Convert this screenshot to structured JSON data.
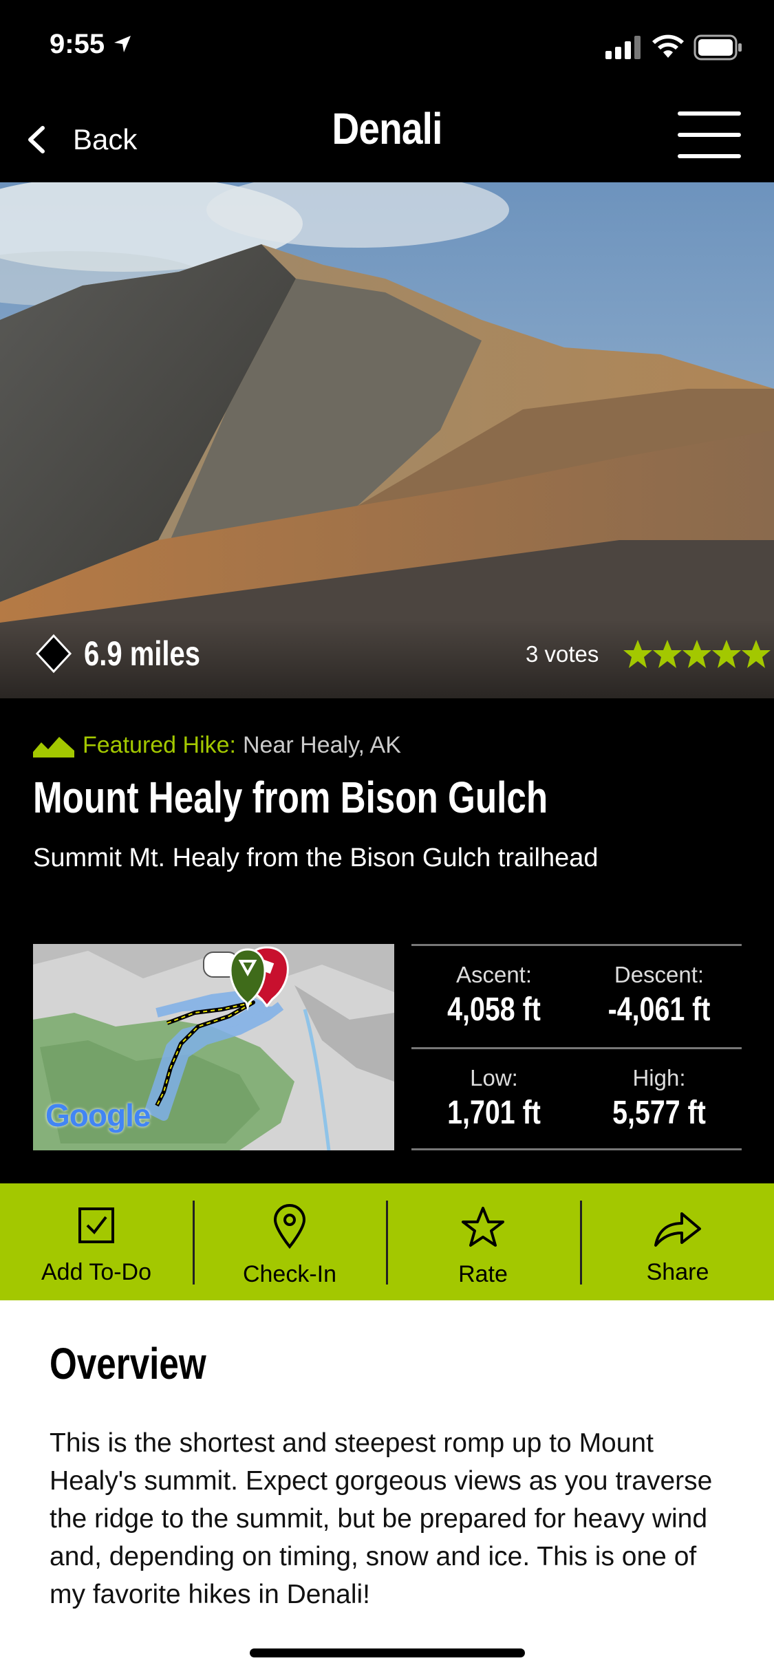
{
  "status": {
    "time": "9:55"
  },
  "nav": {
    "back_label": "Back",
    "title": "Denali"
  },
  "hero": {
    "distance": "6.9 miles",
    "votes": "3 votes",
    "rating_stars": 5
  },
  "hike": {
    "featured_label": "Featured Hike:",
    "location": "Near Healy, AK",
    "title": "Mount Healy from Bison Gulch",
    "subtitle": "Summit Mt. Healy from the Bison Gulch trailhead"
  },
  "map": {
    "logo": "Google"
  },
  "stats": {
    "ascent_label": "Ascent:",
    "ascent_value": "4,058 ft",
    "descent_label": "Descent:",
    "descent_value": "-4,061 ft",
    "low_label": "Low:",
    "low_value": "1,701 ft",
    "high_label": "High:",
    "high_value": "5,577 ft"
  },
  "actions": {
    "todo": "Add To-Do",
    "checkin": "Check-In",
    "rate": "Rate",
    "share": "Share"
  },
  "overview": {
    "title": "Overview",
    "body": "This is the shortest and steepest romp up to Mount Healy's summit. Expect gorgeous views as you traverse the ridge to the summit, but be prepared for heavy wind and, depending on timing, snow and ice. This is one of my favorite hikes in Denali!"
  },
  "colors": {
    "accent": "#a3c800",
    "background": "#000000"
  }
}
